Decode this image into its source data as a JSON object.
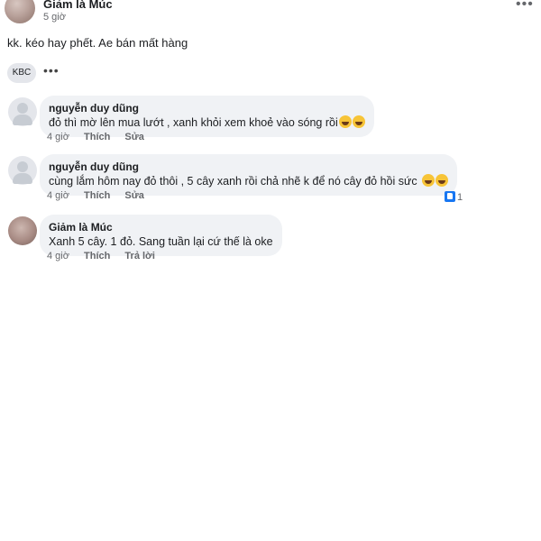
{
  "post": {
    "author": "Giảm là Múc",
    "time": "5 giờ",
    "more_label": "•••",
    "text": "kk. kéo hay phết. Ae bán mất hàng",
    "chip": "KBC",
    "chip_more": "•••"
  },
  "comments": [
    {
      "name": "nguyễn duy dũng",
      "text": "đỏ thì mờ lên mua lướt , xanh khỏi xem khoẻ vào sóng rồi",
      "emoji_count": 2,
      "time": "4 giờ",
      "like": "Thích",
      "action2": "Sửa"
    },
    {
      "name": "nguyễn duy dũng",
      "text": "cùng lắm hôm nay đỏ thôi , 5 cây xanh rồi chả nhẽ k để nó cây đỏ hồi sức",
      "emoji_count": 2,
      "time": "4 giờ",
      "like": "Thích",
      "action2": "Sửa",
      "reaction_count": "1"
    },
    {
      "name": "Giảm là Múc",
      "text": "Xanh 5 cây. 1 đỏ. Sang tuần lại cứ thế là oke",
      "time": "4 giờ",
      "like": "Thích",
      "action2": "Trả lời"
    }
  ],
  "icons": {
    "emoji": "laughing-tears-emoji-icon",
    "like": "thumbs-up-icon"
  },
  "colors": {
    "bubble": "#f0f2f5",
    "meta": "#65676b",
    "like_blue": "#1877f2"
  }
}
